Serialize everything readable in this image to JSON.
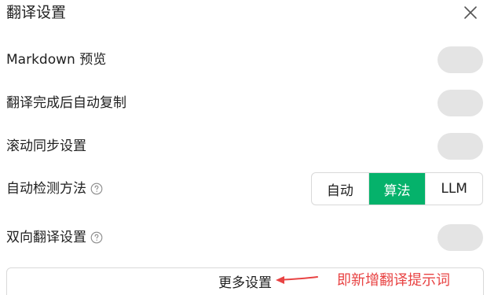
{
  "dialog": {
    "title": "翻译设置",
    "close_icon": "close-icon"
  },
  "settings": {
    "markdown_preview": {
      "label": "Markdown 预览",
      "enabled": false
    },
    "auto_copy": {
      "label": "翻译完成后自动复制",
      "enabled": false
    },
    "scroll_sync": {
      "label": "滚动同步设置",
      "enabled": false
    },
    "auto_detect": {
      "label": "自动检测方法",
      "help_icon": "help-icon",
      "options": [
        "自动",
        "算法",
        "LLM"
      ],
      "selected": "算法"
    },
    "bidirectional": {
      "label": "双向翻译设置",
      "help_icon": "help-icon",
      "enabled": false
    }
  },
  "footer": {
    "more_settings_label": "更多设置"
  },
  "annotation": {
    "text": "即新增翻译提示词",
    "color": "#e84343"
  },
  "colors": {
    "accent": "#05b26b",
    "toggle_off": "#e4e4e4"
  }
}
